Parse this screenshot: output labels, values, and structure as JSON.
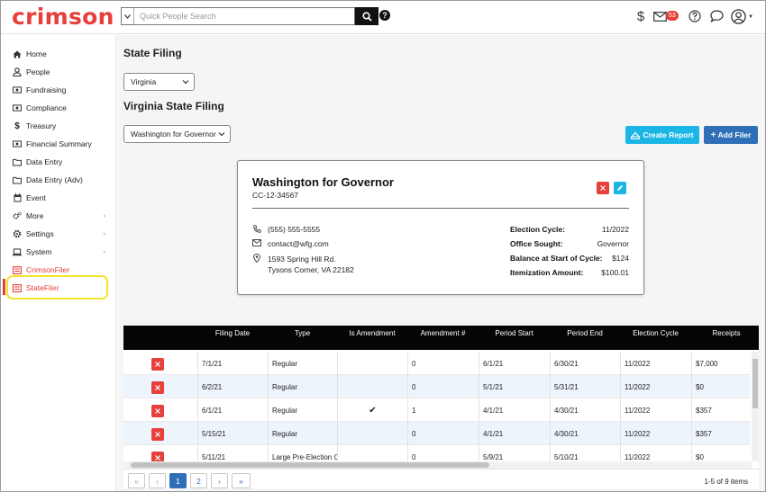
{
  "header": {
    "logo": "crimson",
    "search_placeholder": "Quick People Search",
    "mail_count": "53"
  },
  "sidebar": {
    "items": [
      {
        "label": "Home",
        "icon": "home-icon"
      },
      {
        "label": "People",
        "icon": "person-icon"
      },
      {
        "label": "Fundraising",
        "icon": "money-icon"
      },
      {
        "label": "Compliance",
        "icon": "money-icon"
      },
      {
        "label": "Treasury",
        "icon": "dollar-icon"
      },
      {
        "label": "Financial Summary",
        "icon": "money-icon"
      },
      {
        "label": "Data Entry",
        "icon": "folder-icon"
      },
      {
        "label": "Data Entry (Adv)",
        "icon": "folder-icon"
      },
      {
        "label": "Event",
        "icon": "calendar-icon"
      },
      {
        "label": "More",
        "icon": "cogs-icon"
      },
      {
        "label": "Settings",
        "icon": "gear-icon"
      },
      {
        "label": "System",
        "icon": "laptop-icon"
      },
      {
        "label": "CrimsonFiler",
        "icon": "form-icon"
      },
      {
        "label": "StateFiler",
        "icon": "form-icon"
      }
    ]
  },
  "main": {
    "title": "State Filing",
    "state_select": "Virginia",
    "subtitle": "Virginia State Filing",
    "filer_select": "Washington for Governor",
    "create_report": "Create Report",
    "add_filer": "Add Filer"
  },
  "card": {
    "name": "Washington for Governor",
    "id": "CC-12-34567",
    "phone": "(555) 555-5555",
    "email": "contact@wfg.com",
    "address_line1": "1593 Spring Hill Rd.",
    "address_line2": "Tysons Corner, VA 22182",
    "facts": [
      {
        "label": "Election Cycle:",
        "value": "11/2022"
      },
      {
        "label": "Office Sought:",
        "value": "Governor"
      },
      {
        "label": "Balance at Start of Cycle:",
        "value": "$124"
      },
      {
        "label": "Itemization Amount:",
        "value": "$100.01"
      }
    ]
  },
  "table": {
    "columns": [
      "Filing Date",
      "Type",
      "Is Amendment",
      "Amendment #",
      "Period Start",
      "Period End",
      "Election Cycle",
      "Receipts"
    ],
    "rows": [
      {
        "filing_date": "7/1/21",
        "type": "Regular",
        "is_amendment": "",
        "amendment_no": "0",
        "period_start": "6/1/21",
        "period_end": "6/30/21",
        "election_cycle": "11/2022",
        "receipts": "$7,000"
      },
      {
        "filing_date": "6/2/21",
        "type": "Regular",
        "is_amendment": "",
        "amendment_no": "0",
        "period_start": "5/1/21",
        "period_end": "5/31/21",
        "election_cycle": "11/2022",
        "receipts": "$0"
      },
      {
        "filing_date": "6/1/21",
        "type": "Regular",
        "is_amendment": "✔",
        "amendment_no": "1",
        "period_start": "4/1/21",
        "period_end": "4/30/21",
        "election_cycle": "11/2022",
        "receipts": "$357"
      },
      {
        "filing_date": "5/15/21",
        "type": "Regular",
        "is_amendment": "",
        "amendment_no": "0",
        "period_start": "4/1/21",
        "period_end": "4/30/21",
        "election_cycle": "11/2022",
        "receipts": "$357"
      },
      {
        "filing_date": "5/11/21",
        "type": "Large Pre-Election C",
        "is_amendment": "",
        "amendment_no": "0",
        "period_start": "5/9/21",
        "period_end": "5/10/21",
        "election_cycle": "11/2022",
        "receipts": "$0"
      }
    ]
  },
  "pager": {
    "first": "«",
    "prev": "‹",
    "pages": [
      "1",
      "2"
    ],
    "next": "›",
    "last": "»",
    "info": "1-5 of 9 items"
  }
}
